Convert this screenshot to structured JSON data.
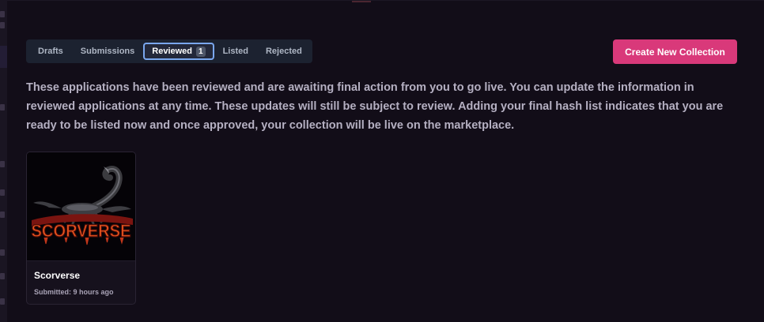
{
  "tabs": [
    {
      "label": "Drafts",
      "count": null
    },
    {
      "label": "Submissions",
      "count": null
    },
    {
      "label": "Reviewed",
      "count": "1",
      "active": true
    },
    {
      "label": "Listed",
      "count": null
    },
    {
      "label": "Rejected",
      "count": null
    }
  ],
  "actions": {
    "create_label": "Create New Collection"
  },
  "description": "These applications have been reviewed and are awaiting final action from you to go live. You can update the information in reviewed applications at any time. These updates will still be subject to review. Adding your final hash list indicates that you are ready to be listed now and once approved, your collection will be live on the marketplace.",
  "collections": [
    {
      "name": "Scorverse",
      "status": "Submitted: 9 hours ago",
      "logo_text": "SCORVERSE",
      "icon": "scorpion-logo"
    }
  ],
  "colors": {
    "accent": "#d9397a",
    "active_tab_outline": "#7aa7ee",
    "background": "#120d18"
  }
}
